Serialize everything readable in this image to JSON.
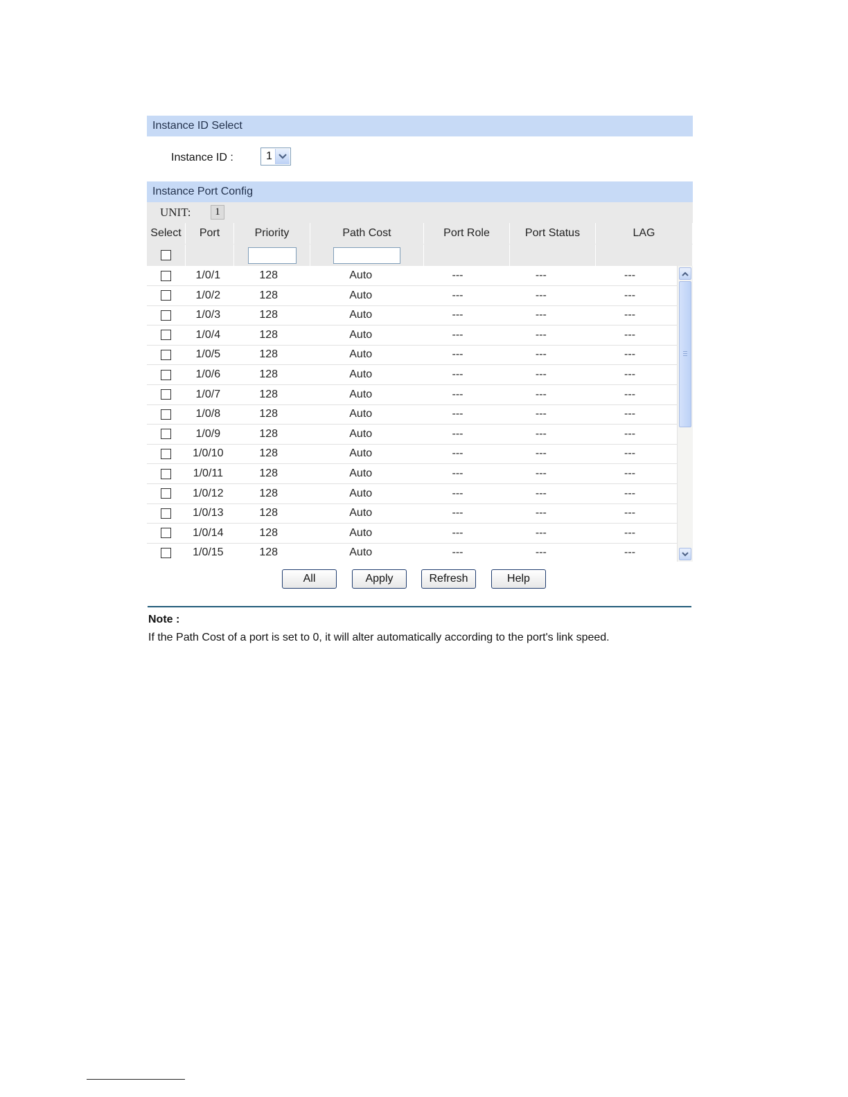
{
  "instance_select": {
    "header": "Instance ID Select",
    "label": "Instance ID :",
    "value": "1"
  },
  "port_config": {
    "header": "Instance Port Config",
    "unit_label": "UNIT:",
    "unit_value": "1",
    "columns": [
      "Select",
      "Port",
      "Priority",
      "Path Cost",
      "Port Role",
      "Port Status",
      "LAG"
    ],
    "filter": {
      "priority": "",
      "path_cost": ""
    },
    "rows": [
      {
        "port": "1/0/1",
        "priority": "128",
        "path_cost": "Auto",
        "role": "---",
        "status": "---",
        "lag": "---"
      },
      {
        "port": "1/0/2",
        "priority": "128",
        "path_cost": "Auto",
        "role": "---",
        "status": "---",
        "lag": "---"
      },
      {
        "port": "1/0/3",
        "priority": "128",
        "path_cost": "Auto",
        "role": "---",
        "status": "---",
        "lag": "---"
      },
      {
        "port": "1/0/4",
        "priority": "128",
        "path_cost": "Auto",
        "role": "---",
        "status": "---",
        "lag": "---"
      },
      {
        "port": "1/0/5",
        "priority": "128",
        "path_cost": "Auto",
        "role": "---",
        "status": "---",
        "lag": "---"
      },
      {
        "port": "1/0/6",
        "priority": "128",
        "path_cost": "Auto",
        "role": "---",
        "status": "---",
        "lag": "---"
      },
      {
        "port": "1/0/7",
        "priority": "128",
        "path_cost": "Auto",
        "role": "---",
        "status": "---",
        "lag": "---"
      },
      {
        "port": "1/0/8",
        "priority": "128",
        "path_cost": "Auto",
        "role": "---",
        "status": "---",
        "lag": "---"
      },
      {
        "port": "1/0/9",
        "priority": "128",
        "path_cost": "Auto",
        "role": "---",
        "status": "---",
        "lag": "---"
      },
      {
        "port": "1/0/10",
        "priority": "128",
        "path_cost": "Auto",
        "role": "---",
        "status": "---",
        "lag": "---"
      },
      {
        "port": "1/0/11",
        "priority": "128",
        "path_cost": "Auto",
        "role": "---",
        "status": "---",
        "lag": "---"
      },
      {
        "port": "1/0/12",
        "priority": "128",
        "path_cost": "Auto",
        "role": "---",
        "status": "---",
        "lag": "---"
      },
      {
        "port": "1/0/13",
        "priority": "128",
        "path_cost": "Auto",
        "role": "---",
        "status": "---",
        "lag": "---"
      },
      {
        "port": "1/0/14",
        "priority": "128",
        "path_cost": "Auto",
        "role": "---",
        "status": "---",
        "lag": "---"
      },
      {
        "port": "1/0/15",
        "priority": "128",
        "path_cost": "Auto",
        "role": "---",
        "status": "---",
        "lag": "---"
      }
    ]
  },
  "buttons": {
    "all": "All",
    "apply": "Apply",
    "refresh": "Refresh",
    "help": "Help"
  },
  "note": {
    "title": "Note :",
    "text": "If the Path Cost of a port is set to 0, it will alter automatically according to the port's link speed."
  },
  "colors": {
    "section_header_bg": "#c7daf6",
    "table_header_bg": "#e9e9e9",
    "note_rule": "#205a78"
  },
  "icons": {
    "dropdown": "chevron-down-icon",
    "scroll_up": "chevron-up-icon",
    "scroll_down": "chevron-down-icon"
  }
}
